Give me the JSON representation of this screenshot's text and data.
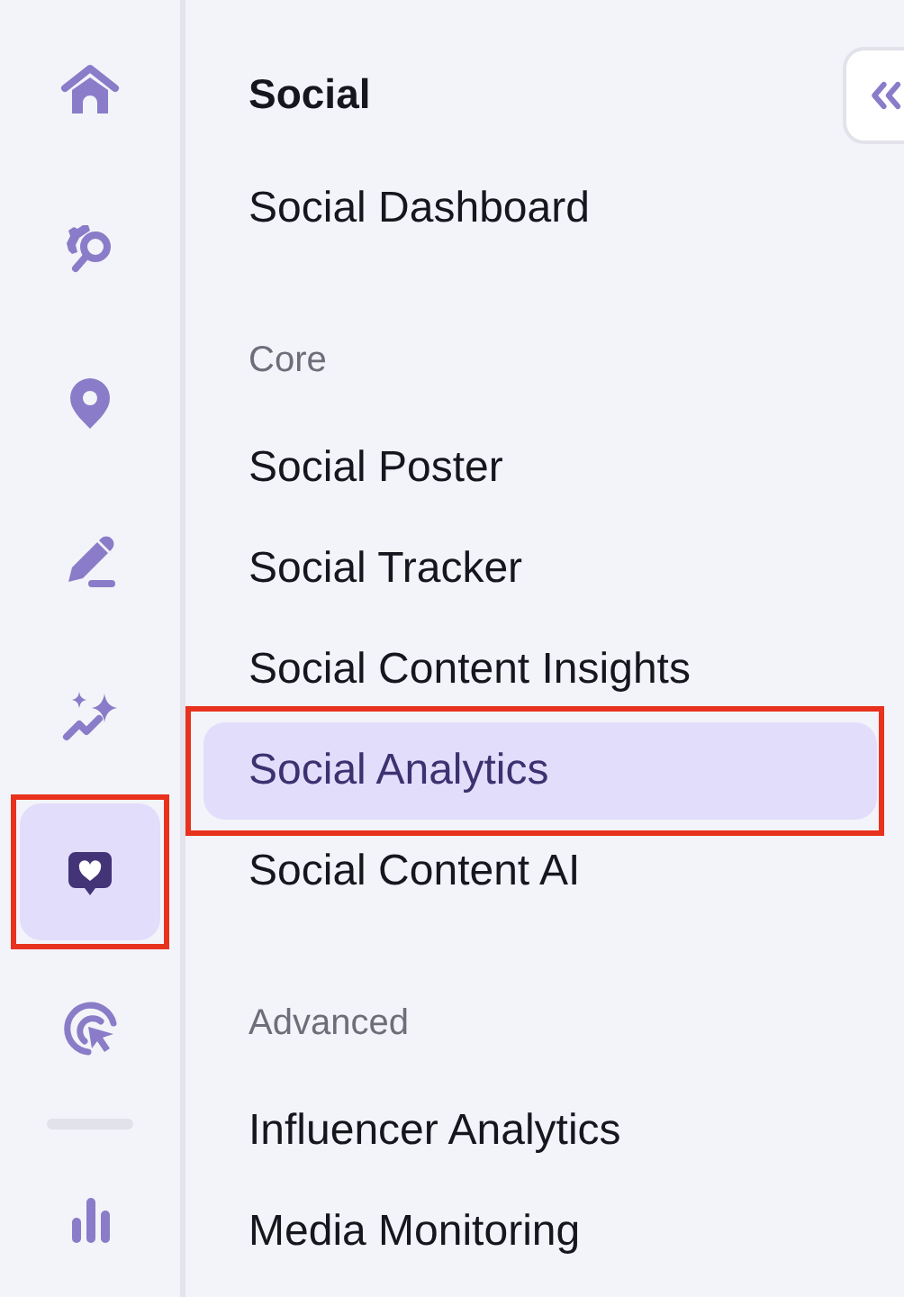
{
  "rail": {
    "items": [
      {
        "kind": "home",
        "selected": false,
        "highlighted": false
      },
      {
        "kind": "gear-search",
        "selected": false,
        "highlighted": false
      },
      {
        "kind": "pin",
        "selected": false,
        "highlighted": false
      },
      {
        "kind": "pencil",
        "selected": false,
        "highlighted": false
      },
      {
        "kind": "sparkle",
        "selected": false,
        "highlighted": false
      },
      {
        "kind": "heart-chat",
        "selected": true,
        "highlighted": true
      },
      {
        "kind": "cursor-target",
        "selected": false,
        "highlighted": false
      },
      {
        "kind": "divider"
      },
      {
        "kind": "bar-chart",
        "selected": false,
        "highlighted": false
      }
    ]
  },
  "menu": {
    "title": "Social",
    "sections": [
      {
        "items": [
          {
            "label": "Social Dashboard",
            "selected": false,
            "highlighted": false
          }
        ]
      },
      {
        "label": "Core",
        "items": [
          {
            "label": "Social Poster",
            "selected": false,
            "highlighted": false
          },
          {
            "label": "Social Tracker",
            "selected": false,
            "highlighted": false
          },
          {
            "label": "Social Content Insights",
            "selected": false,
            "highlighted": false
          },
          {
            "label": "Social Analytics",
            "selected": true,
            "highlighted": true
          },
          {
            "label": "Social Content AI",
            "selected": false,
            "highlighted": false
          }
        ]
      },
      {
        "label": "Advanced",
        "items": [
          {
            "label": "Influencer Analytics",
            "selected": false,
            "highlighted": false
          },
          {
            "label": "Media Monitoring",
            "selected": false,
            "highlighted": false
          }
        ]
      }
    ]
  }
}
